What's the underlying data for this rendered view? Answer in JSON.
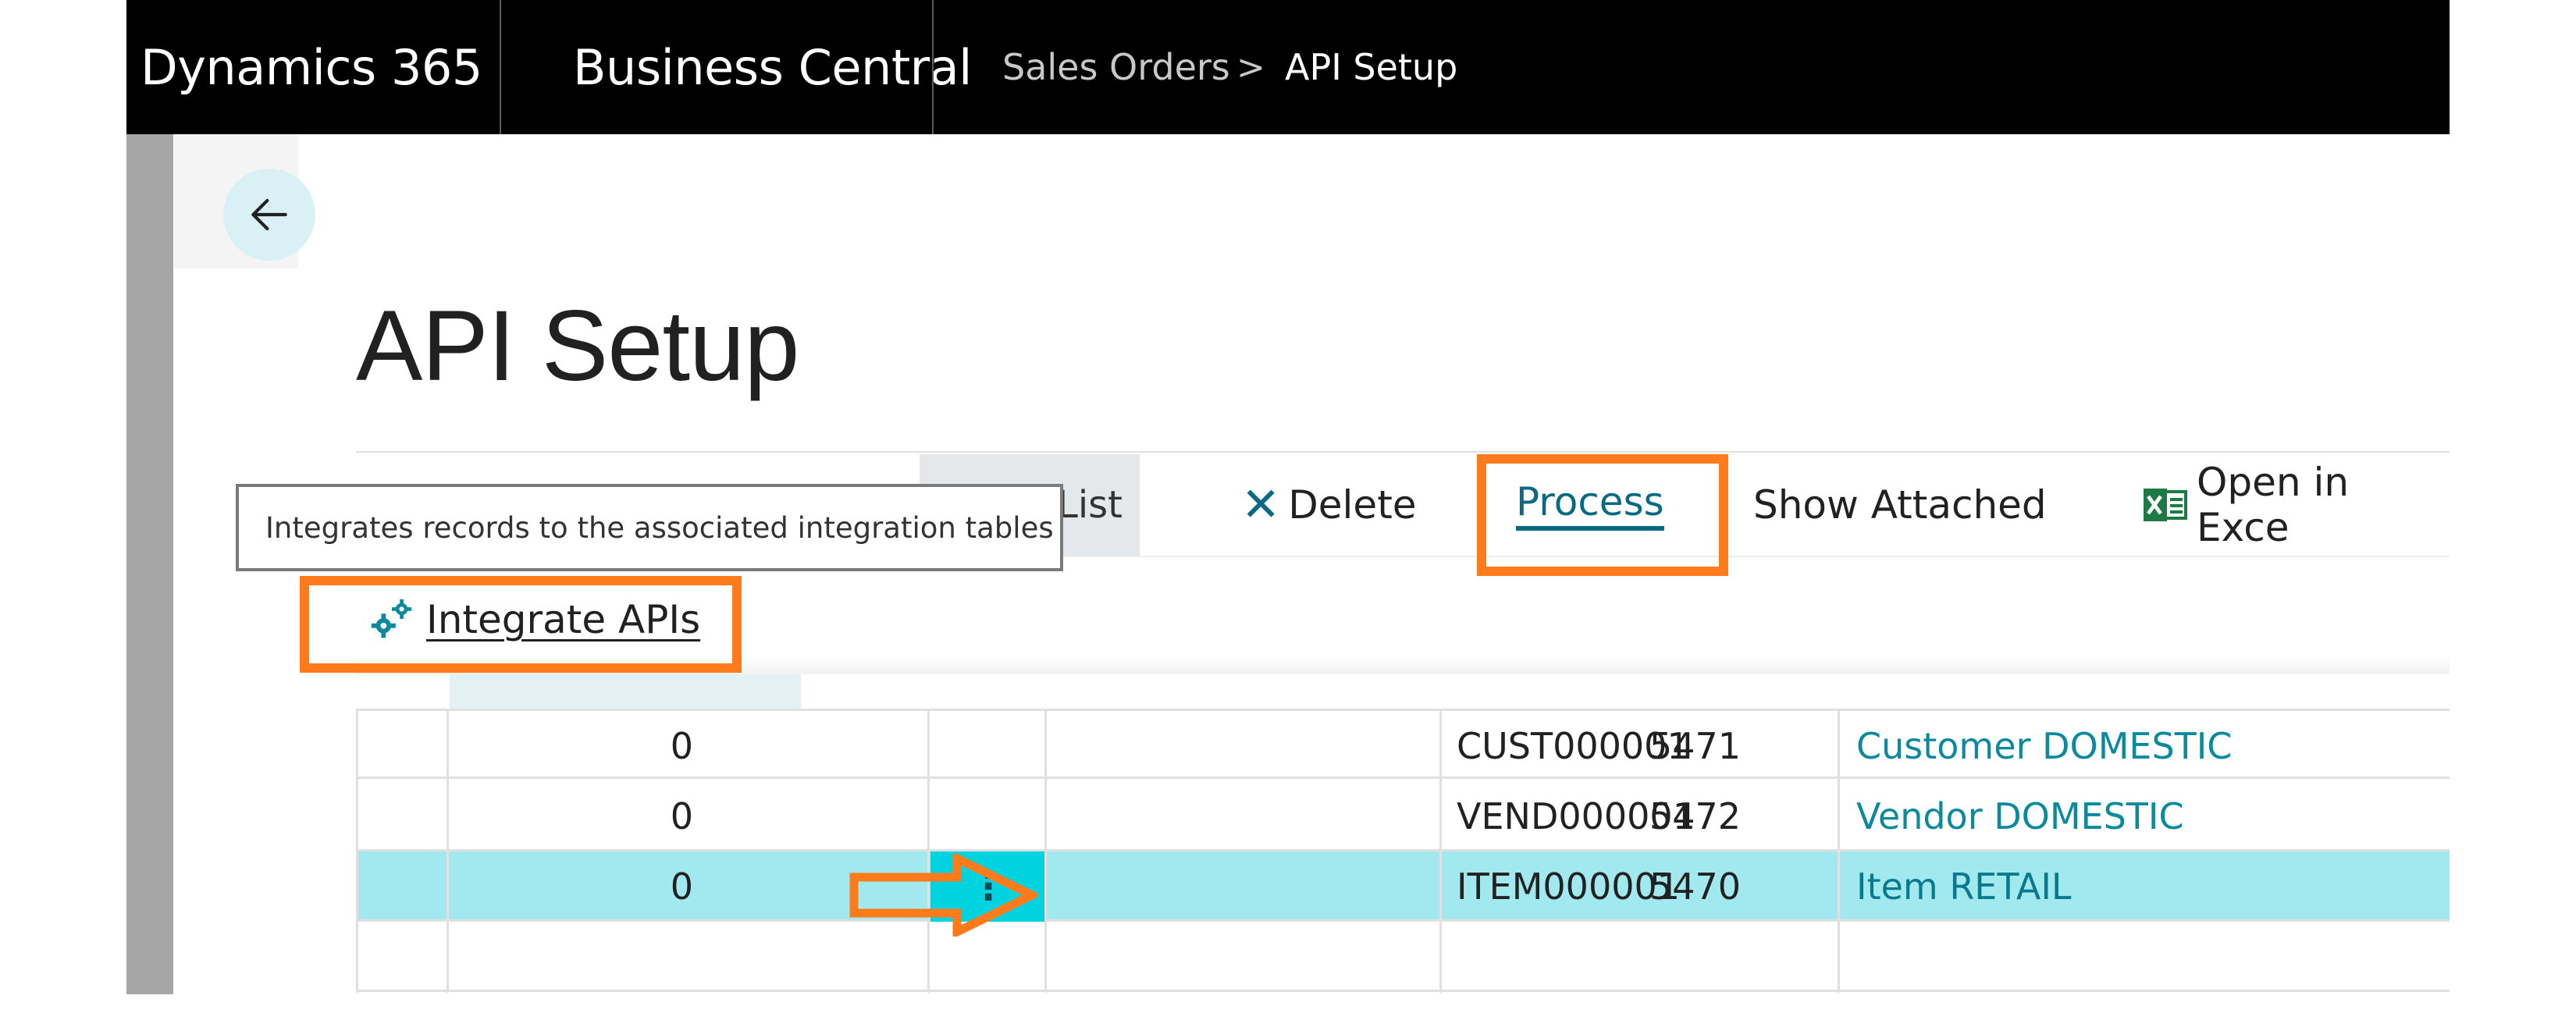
{
  "topbar": {
    "brand": "Dynamics 365",
    "product": "Business Central",
    "breadcrumb_parent": "Sales Orders",
    "breadcrumb_separator": ">",
    "breadcrumb_current": "API Setup"
  },
  "page": {
    "title": "API Setup"
  },
  "actions": {
    "list_label": "List",
    "delete_label": "Delete",
    "process_label": "Process",
    "show_attached_label": "Show Attached",
    "open_in_excel_label": "Open in Exce"
  },
  "tooltip": {
    "text": "Integrates records to the associated integration tables"
  },
  "dropdown": {
    "integrate_label": "Integrate APIs"
  },
  "rows": [
    {
      "count": "0",
      "id": "5471",
      "code": "CUST000001",
      "description": "Customer DOMESTIC",
      "selected": false
    },
    {
      "count": "0",
      "id": "5472",
      "code": "VEND000001",
      "description": "Vendor DOMESTIC",
      "selected": false
    },
    {
      "count": "0",
      "id": "5470",
      "code": "ITEM000001",
      "description": "Item RETAIL",
      "selected": true
    }
  ],
  "row_menu_glyph": "⋮",
  "colors": {
    "accent": "#0b6a83",
    "link": "#0b8a9e",
    "selected_row": "#a2e8ef",
    "highlight": "#ff7a1a"
  }
}
